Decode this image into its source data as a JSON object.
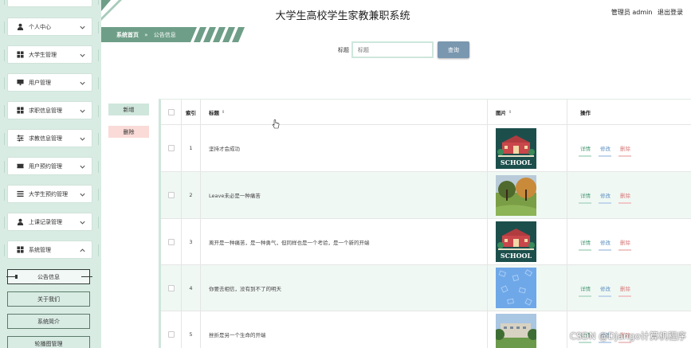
{
  "header": {
    "app_title": "大学生高校学生家教兼职系统",
    "user_label": "管理员 admin",
    "logout_label": "退出登录"
  },
  "breadcrumb": {
    "home": "系统首页",
    "separator": "»",
    "current": "公告信息"
  },
  "sidebar": {
    "menus": [
      {
        "label": "个人中心",
        "icon": "user-icon"
      },
      {
        "label": "大学生管理",
        "icon": "grid-icon"
      },
      {
        "label": "用户管理",
        "icon": "monitor-icon"
      },
      {
        "label": "求职信息管理",
        "icon": "grid-icon"
      },
      {
        "label": "求教信息管理",
        "icon": "sliders-icon"
      },
      {
        "label": "用户预约管理",
        "icon": "ticket-icon"
      },
      {
        "label": "大学生预约管理",
        "icon": "list-icon"
      },
      {
        "label": "上课记录管理",
        "icon": "user-icon"
      },
      {
        "label": "系统管理",
        "icon": "grid-icon"
      }
    ],
    "sub_items": [
      {
        "label": "公告信息",
        "active": true
      },
      {
        "label": "关于我们",
        "active": false
      },
      {
        "label": "系统简介",
        "active": false
      },
      {
        "label": "轮播图管理",
        "active": false
      }
    ]
  },
  "search": {
    "label": "标题",
    "placeholder": "标题",
    "button_label": "查询"
  },
  "actions": {
    "add_label": "新增",
    "delete_label": "删除"
  },
  "table": {
    "headers": {
      "index": "索引",
      "title": "标题",
      "image": "图片",
      "operations": "操作"
    },
    "operation_labels": {
      "detail": "详情",
      "edit": "修改",
      "delete": "删除"
    },
    "rows": [
      {
        "index": "1",
        "title": "坚持才会成功",
        "image": "school-badge"
      },
      {
        "index": "2",
        "title": "Leave未必是一种痛苦",
        "image": "park-photo"
      },
      {
        "index": "3",
        "title": "离开是一种痛苦，是一种勇气，但同样也是一个考验，是一个新的开端",
        "image": "school-badge"
      },
      {
        "index": "4",
        "title": "你要去相信，没有到不了的明天",
        "image": "blue-pattern"
      },
      {
        "index": "5",
        "title": "挫折是另一个生命的开端",
        "image": "campus-photo"
      }
    ]
  },
  "school_badge_text": "SCHOOL",
  "watermark": "CSDN @Django计算机程序",
  "colors": {
    "sidebar_bg": "#d9ece4",
    "accent_green": "#6e9e87",
    "search_button": "#7a97b0",
    "add_button": "#cfe6dc",
    "delete_button": "#fadbd8",
    "row_alt": "#f0f8f4"
  }
}
